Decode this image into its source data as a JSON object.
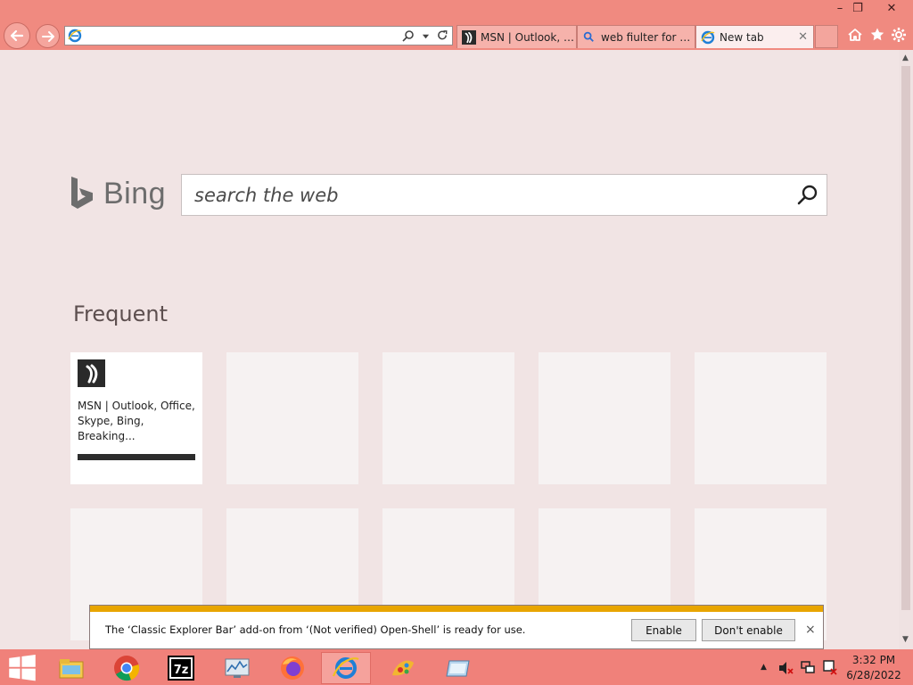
{
  "window": {
    "minimize_glyph": "–",
    "restore_glyph": "❐",
    "close_glyph": "✕"
  },
  "address_bar": {
    "value": "",
    "search_icon": "search-icon",
    "dropdown_icon": "chevron-down-icon",
    "refresh_icon": "refresh-icon"
  },
  "tabs": [
    {
      "label": "MSN | Outlook, Of...",
      "icon": "msn-icon"
    },
    {
      "label": "web fiulter for win...",
      "icon": "search-icon"
    },
    {
      "label": "New tab",
      "icon": "ie-icon",
      "active": true,
      "close": "✕"
    }
  ],
  "toolbar_icons": [
    "home-icon",
    "star-icon",
    "gear-icon"
  ],
  "bing": {
    "logo_text": "Bing",
    "search_placeholder": "search the web"
  },
  "frequent": {
    "title": "Frequent",
    "tiles": [
      {
        "title": "MSN | Outlook, Office, Skype, Bing, Breaking...",
        "icon": "msn-icon"
      }
    ]
  },
  "notification": {
    "message": "The ‘Classic Explorer Bar’ add-on from ‘(Not verified) Open-Shell’ is ready for use.",
    "enable_label": "Enable",
    "dont_enable_label": "Don't enable",
    "close_glyph": "×",
    "accent_color": "#e8a500"
  },
  "taskbar": {
    "items": [
      "start-icon",
      "file-explorer-icon",
      "chrome-icon",
      "7zip-icon",
      "resource-monitor-icon",
      "firefox-icon",
      "internet-explorer-icon",
      "paint-icon",
      "window-icon"
    ],
    "tray": {
      "expand_glyph": "▲",
      "time": "3:32 PM",
      "date": "6/28/2022"
    }
  },
  "colors": {
    "titlebar": "#f08a80",
    "page_background": "#f1e4e4",
    "taskbar": "#f0817a"
  }
}
